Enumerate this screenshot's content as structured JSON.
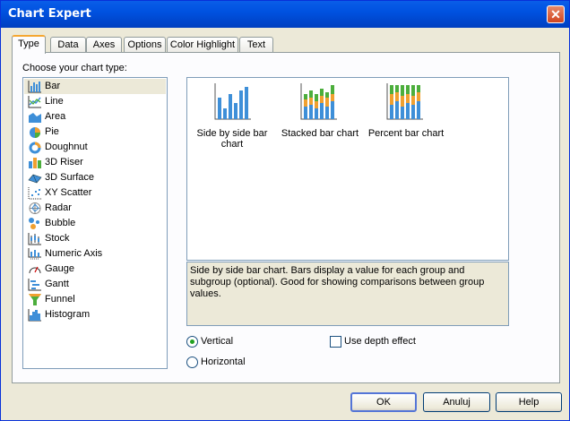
{
  "window": {
    "title": "Chart Expert"
  },
  "tabs": [
    {
      "label": "Type",
      "active": true
    },
    {
      "label": "Data"
    },
    {
      "label": "Axes"
    },
    {
      "label": "Options"
    },
    {
      "label": "Color Highlight"
    },
    {
      "label": "Text"
    }
  ],
  "type_panel": {
    "prompt": "Choose your chart type:",
    "items": [
      {
        "label": "Bar",
        "icon": "bar-chart-icon",
        "selected": true
      },
      {
        "label": "Line",
        "icon": "line-chart-icon"
      },
      {
        "label": "Area",
        "icon": "area-chart-icon"
      },
      {
        "label": "Pie",
        "icon": "pie-chart-icon"
      },
      {
        "label": "Doughnut",
        "icon": "doughnut-chart-icon"
      },
      {
        "label": "3D Riser",
        "icon": "3d-riser-chart-icon"
      },
      {
        "label": "3D Surface",
        "icon": "3d-surface-chart-icon"
      },
      {
        "label": "XY Scatter",
        "icon": "xy-scatter-chart-icon"
      },
      {
        "label": "Radar",
        "icon": "radar-chart-icon"
      },
      {
        "label": "Bubble",
        "icon": "bubble-chart-icon"
      },
      {
        "label": "Stock",
        "icon": "stock-chart-icon"
      },
      {
        "label": "Numeric Axis",
        "icon": "numeric-axis-chart-icon"
      },
      {
        "label": "Gauge",
        "icon": "gauge-chart-icon"
      },
      {
        "label": "Gantt",
        "icon": "gantt-chart-icon"
      },
      {
        "label": "Funnel",
        "icon": "funnel-chart-icon"
      },
      {
        "label": "Histogram",
        "icon": "histogram-chart-icon"
      }
    ]
  },
  "subtypes": [
    {
      "label": "Side by side bar chart",
      "icon": "side-by-side-bar-icon"
    },
    {
      "label": "Stacked bar chart",
      "icon": "stacked-bar-icon"
    },
    {
      "label": "Percent bar chart",
      "icon": "percent-bar-icon"
    }
  ],
  "description": "Side by side bar chart. Bars display a value for each group and subgroup (optional). Good for showing comparisons between group values.",
  "orientation": {
    "vertical_label": "Vertical",
    "horizontal_label": "Horizontal",
    "selected": "Vertical"
  },
  "depth": {
    "label": "Use depth effect",
    "checked": false
  },
  "buttons": {
    "ok": "OK",
    "cancel": "Anuluj",
    "help": "Help"
  },
  "colors": {
    "title_bar": "#0054e3",
    "tab_highlight": "#f5a731",
    "bar_blue": "#3e8fd8",
    "bar_green": "#4cae3c",
    "bar_orange": "#f0a030"
  }
}
